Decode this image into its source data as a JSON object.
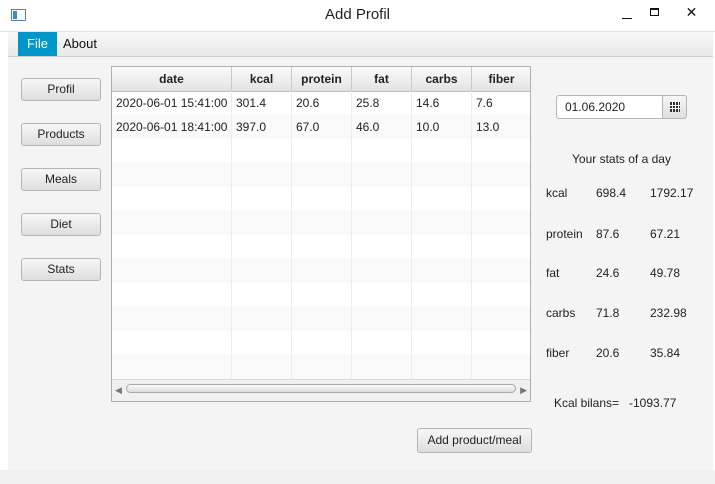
{
  "window": {
    "title": "Add Profil",
    "close_glyph": "✕"
  },
  "menu": {
    "items": [
      {
        "label": "File"
      },
      {
        "label": "About"
      }
    ]
  },
  "sidebar": {
    "buttons": [
      {
        "label": "Profil"
      },
      {
        "label": "Products"
      },
      {
        "label": "Meals"
      },
      {
        "label": "Diet"
      },
      {
        "label": "Stats"
      }
    ]
  },
  "table": {
    "columns": [
      "date",
      "kcal",
      "protein",
      "fat",
      "carbs",
      "fiber"
    ],
    "rows": [
      [
        "2020-06-01 15:41:00",
        "301.4",
        "20.6",
        "25.8",
        "14.6",
        "7.6"
      ],
      [
        "2020-06-01 18:41:00",
        "397.0",
        "67.0",
        "46.0",
        "10.0",
        "13.0"
      ]
    ]
  },
  "date_picker": {
    "value": "01.06.2020",
    "icon": "calendar-icon"
  },
  "stats": {
    "title": "Your stats of a day",
    "rows": [
      {
        "label": "kcal",
        "value": "698.4",
        "target": "1792.17"
      },
      {
        "label": "protein",
        "value": "87.6",
        "target": "67.21"
      },
      {
        "label": "fat",
        "value": "24.6",
        "target": "49.78"
      },
      {
        "label": "carbs",
        "value": "71.8",
        "target": "232.98"
      },
      {
        "label": "fiber",
        "value": "20.6",
        "target": "35.84"
      }
    ],
    "bilans_label": "Kcal bilans=",
    "bilans_value": "-1093.77"
  },
  "actions": {
    "add_label": "Add product/meal"
  },
  "colors": {
    "menu_active": "#0096c9",
    "background": "#f4f4f4"
  }
}
